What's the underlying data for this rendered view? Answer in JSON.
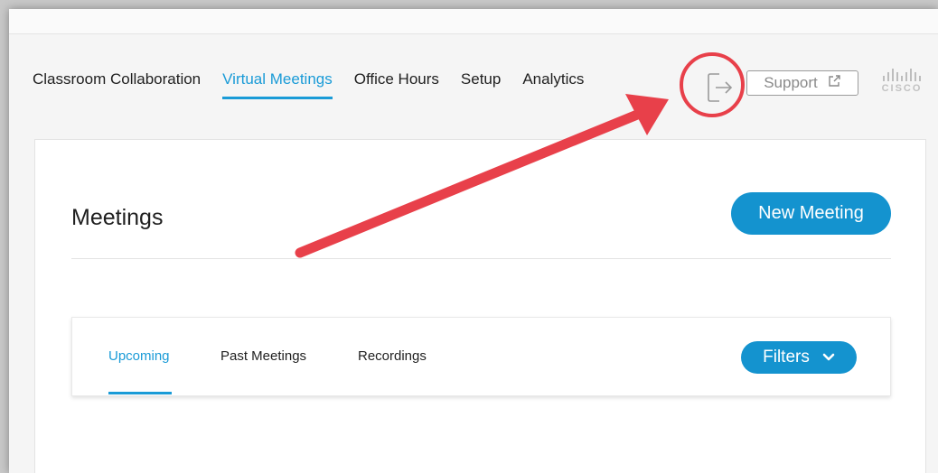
{
  "nav": {
    "items": [
      {
        "label": "Classroom Collaboration",
        "active": false
      },
      {
        "label": "Virtual Meetings",
        "active": true
      },
      {
        "label": "Office Hours",
        "active": false
      },
      {
        "label": "Setup",
        "active": false
      },
      {
        "label": "Analytics",
        "active": false
      }
    ]
  },
  "header": {
    "support_label": "Support",
    "logo_text": "CISCO"
  },
  "main": {
    "title": "Meetings",
    "new_meeting_label": "New Meeting",
    "tabs": [
      {
        "label": "Upcoming",
        "active": true
      },
      {
        "label": "Past Meetings",
        "active": false
      },
      {
        "label": "Recordings",
        "active": false
      }
    ],
    "filters_label": "Filters"
  },
  "colors": {
    "accent": "#1a9bd7",
    "button": "#1493cf",
    "annotation": "#e8404a"
  },
  "icons": {
    "logout": "logout-icon",
    "external_link": "external-link-icon",
    "chevron": "chevron-down-icon"
  }
}
